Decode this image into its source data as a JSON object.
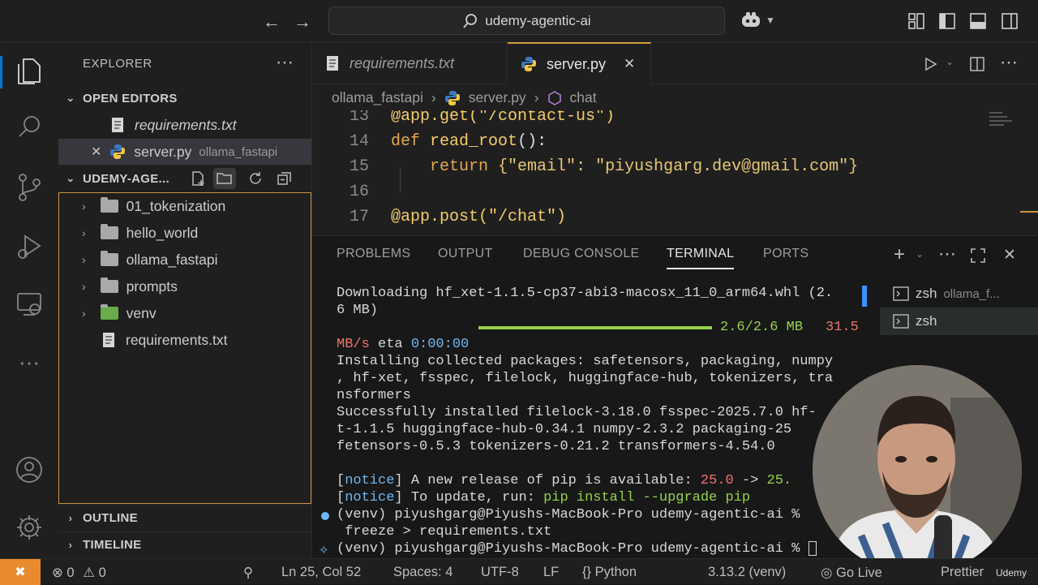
{
  "titlebar": {
    "search_text": "udemy-agentic-ai",
    "back_icon": "arrow-left-icon",
    "forward_icon": "arrow-right-icon"
  },
  "sidebar": {
    "title": "EXPLORER",
    "open_editors_label": "OPEN EDITORS",
    "open_editors": [
      {
        "name": "requirements.txt",
        "desc": ""
      },
      {
        "name": "server.py",
        "desc": "ollama_fastapi"
      }
    ],
    "workspace_label": "UDEMY-AGE...",
    "tree": [
      {
        "name": "01_tokenization",
        "type": "folder"
      },
      {
        "name": "hello_world",
        "type": "folder"
      },
      {
        "name": "ollama_fastapi",
        "type": "folder"
      },
      {
        "name": "prompts",
        "type": "folder"
      },
      {
        "name": "venv",
        "type": "folder"
      },
      {
        "name": "requirements.txt",
        "type": "file"
      }
    ],
    "outline_label": "OUTLINE",
    "timeline_label": "TIMELINE"
  },
  "editor": {
    "tabs": [
      {
        "label": "requirements.txt"
      },
      {
        "label": "server.py"
      }
    ],
    "breadcrumb": [
      "ollama_fastapi",
      "server.py",
      "chat"
    ],
    "lines": [
      {
        "n": "13",
        "a": "@app.get(\"/contact-us\")"
      },
      {
        "n": "14",
        "a": "def",
        "b": "read_root",
        "c": "():"
      },
      {
        "n": "15",
        "a": "return",
        "b": "{\"email\": \"piyushgarg.dev@gmail.com\"}"
      },
      {
        "n": "16",
        "a": ""
      },
      {
        "n": "17",
        "a": "@app.post(\"/chat\")"
      }
    ]
  },
  "panel": {
    "tabs": [
      "PROBLEMS",
      "OUTPUT",
      "DEBUG CONSOLE",
      "TERMINAL",
      "PORTS"
    ],
    "terminals": [
      {
        "name": "zsh",
        "desc": "ollama_f..."
      },
      {
        "name": "zsh",
        "desc": ""
      }
    ],
    "terminal": {
      "l1": "Downloading hf_xet-1.1.5-cp37-abi3-macosx_11_0_arm64.whl (2.",
      "l2": "6 MB)",
      "progress_text": "2.6/2.6 MB",
      "progress_speed": "31.5",
      "progress_fraction": 1.0,
      "l3a": "MB/s",
      "l3b": "eta",
      "l3c": "0:00:00",
      "l4": "Installing collected packages: safetensors, packaging, numpy",
      "l5": ", hf-xet, fsspec, filelock, huggingface-hub, tokenizers, tra",
      "l6": "nsformers",
      "l7": "Successfully installed filelock-3.18.0 fsspec-2025.7.0 hf-",
      "l8": "t-1.1.5 huggingface-hub-0.34.1 numpy-2.3.2 packaging-25",
      "l9": "fetensors-0.5.3 tokenizers-0.21.2 transformers-4.54.0",
      "notice": "notice",
      "l10a": " A new release of pip is available: ",
      "l10b": "25.0",
      "l10c": " -> ",
      "l10d": "25.",
      "l11a": " To update, run: ",
      "l11b": "pip install --upgrade pip",
      "l12": "(venv) piyushgarg@Piyushs-MacBook-Pro udemy-agentic-ai %",
      "l13": " freeze > requirements.txt",
      "l14": "(venv) piyushgarg@Piyushs-MacBook-Pro udemy-agentic-ai %"
    }
  },
  "statusbar": {
    "errors": "0",
    "warnings": "0",
    "position": "Ln 25, Col 52",
    "spaces": "Spaces: 4",
    "encoding": "UTF-8",
    "eol": "LF",
    "language": "Python",
    "interpreter": "3.13.2 (venv)",
    "golive": "Go Live",
    "prettier": "Prettier",
    "watermark": "Udemy"
  },
  "colors": {
    "accent": "#0078d4",
    "progress": "#96d24b",
    "statusbar_remote": "#ea8a2f"
  }
}
